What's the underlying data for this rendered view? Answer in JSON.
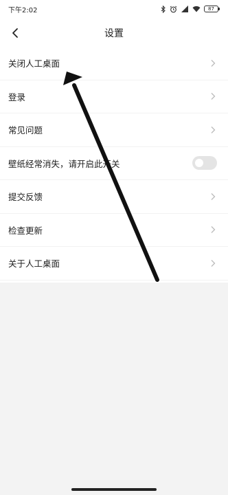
{
  "status_bar": {
    "time": "下午2:02",
    "battery": "87",
    "icons": [
      "bluetooth-icon",
      "alarm-icon",
      "signal-icon",
      "wifi-icon",
      "battery-icon"
    ]
  },
  "header": {
    "title": "设置",
    "back_icon": "back-icon"
  },
  "settings": {
    "items": [
      {
        "label": "关闭人工桌面",
        "control": "chevron"
      },
      {
        "label": "登录",
        "control": "chevron"
      },
      {
        "label": "常见问题",
        "control": "chevron"
      },
      {
        "label": "壁纸经常消失，请开启此开关",
        "control": "toggle",
        "toggle_on": false
      },
      {
        "label": "提交反馈",
        "control": "chevron"
      },
      {
        "label": "检查更新",
        "control": "chevron"
      },
      {
        "label": "关于人工桌面",
        "control": "chevron"
      }
    ]
  },
  "colors": {
    "background": "#f3f3f3",
    "surface": "#ffffff",
    "text": "#222222",
    "chevron": "#bbbbbb",
    "toggle_off": "#e4e4e4",
    "annotation_arrow": "#111111"
  }
}
